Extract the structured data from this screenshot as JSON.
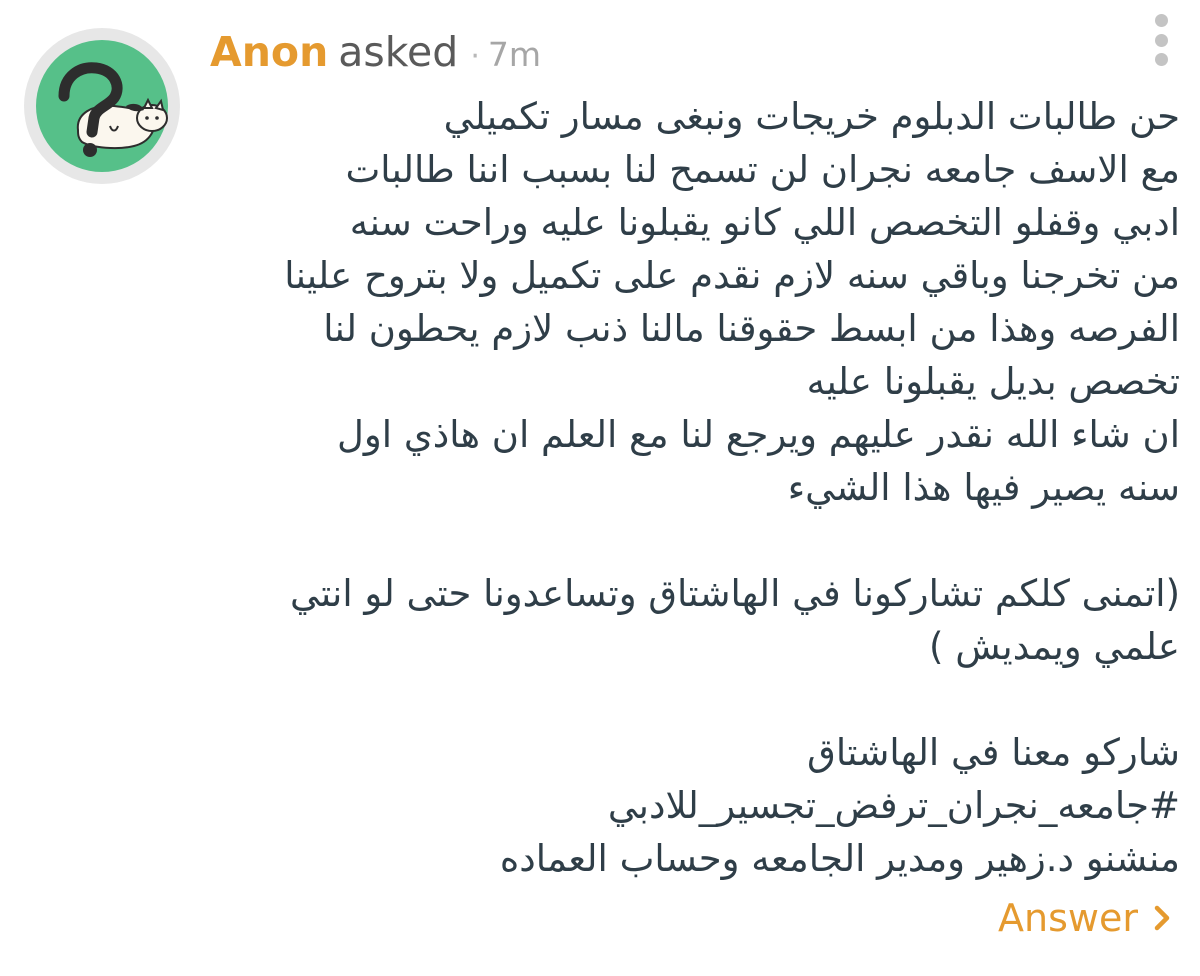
{
  "header": {
    "author": "Anon",
    "action": "asked",
    "separator": "·",
    "time": "7m"
  },
  "avatar": {
    "icon": "question-mark-cat-avatar",
    "background_color": "#56c089",
    "ring_color": "#e7e7e7"
  },
  "menu": {
    "icon": "vertical-ellipsis-icon"
  },
  "question": {
    "lines": [
      "حن طالبات الدبلوم خريجات ونبغى مسار تكميلي",
      "مع الاسف جامعه نجران لن تسمح لنا بسبب اننا طالبات",
      "ادبي وقفلو التخصص اللي كانو يقبلونا عليه وراحت سنه",
      "من تخرجنا وباقي سنه لازم نقدم على تكميل ولا بتروح علينا",
      "الفرصه وهذا من ابسط حقوقنا مالنا ذنب لازم يحطون لنا",
      "تخصص بديل يقبلونا عليه",
      "ان شاء الله نقدر عليهم ويرجع لنا مع العلم ان هاذي اول",
      "سنه يصير فيها هذا الشيء",
      "",
      "(اتمنى كلكم تشاركونا في الهاشتاق وتساعدونا حتى لو انتي",
      "علمي ويمديش )",
      "",
      "شاركو معنا في الهاشتاق",
      "#جامعه_نجران_ترفض_تجسير_للادبي",
      "منشنو د.زهير ومدير الجامعه وحساب العماده"
    ]
  },
  "answer": {
    "label": "Answer",
    "icon": "chevron-right-icon"
  },
  "colors": {
    "accent": "#e59a2f",
    "text": "#2f3e48",
    "muted": "#a6a6a6"
  }
}
